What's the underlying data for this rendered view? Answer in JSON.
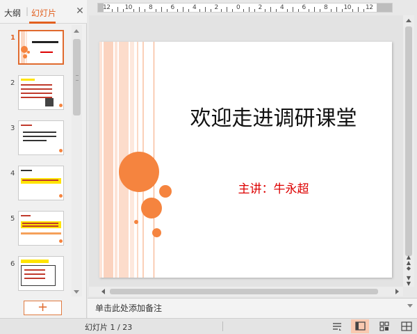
{
  "panel": {
    "tab_outline": "大纲",
    "tab_separator": "|",
    "tab_slides": "幻灯片",
    "close_symbol": "✕"
  },
  "thumbnails": [
    {
      "number": "1",
      "active": true
    },
    {
      "number": "2",
      "active": false
    },
    {
      "number": "3",
      "active": false
    },
    {
      "number": "4",
      "active": false
    },
    {
      "number": "5",
      "active": false
    },
    {
      "number": "6",
      "active": false
    }
  ],
  "add_slide_symbol": "+",
  "ruler": {
    "labels": [
      "12",
      "10",
      "8",
      "6",
      "4",
      "2",
      "0",
      "2",
      "4",
      "6",
      "8",
      "10",
      "12"
    ]
  },
  "slide": {
    "title": "欢迎走进调研课堂",
    "subtitle": "主讲：牛永超",
    "accent_color": "#f5843f",
    "subtitle_color": "#dd0000"
  },
  "notes": {
    "placeholder": "单击此处添加备注"
  },
  "status": {
    "slide_indicator": "幻灯片 1 / 23"
  },
  "view_buttons": [
    {
      "name": "notes-view-icon",
      "active": false
    },
    {
      "name": "normal-view-icon",
      "active": true
    },
    {
      "name": "slide-sorter-icon",
      "active": false
    },
    {
      "name": "reading-view-icon",
      "active": false
    }
  ]
}
